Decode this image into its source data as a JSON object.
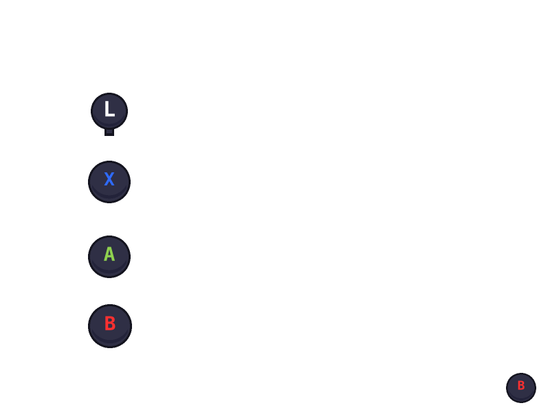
{
  "palette": {
    "background": "#ffffff",
    "outline": "#14141f",
    "button_fill": "#2f2f45",
    "button_shadow": "#23233a",
    "button_highlight": "#3d3d58"
  },
  "buttons": [
    {
      "id": "l",
      "label": "L",
      "color": "#ffffff",
      "icon": "shoulder-button-l-icon",
      "has_stem": true
    },
    {
      "id": "x",
      "label": "X",
      "color": "#2f6bff",
      "icon": "face-button-x-icon",
      "has_stem": false
    },
    {
      "id": "a",
      "label": "A",
      "color": "#8fd14f",
      "icon": "face-button-a-icon",
      "has_stem": false
    },
    {
      "id": "b",
      "label": "B",
      "color": "#ff3030",
      "icon": "face-button-b-icon",
      "has_stem": false
    },
    {
      "id": "b-small",
      "label": "B",
      "color": "#ff3030",
      "icon": "face-button-b-small-icon",
      "has_stem": false
    }
  ]
}
